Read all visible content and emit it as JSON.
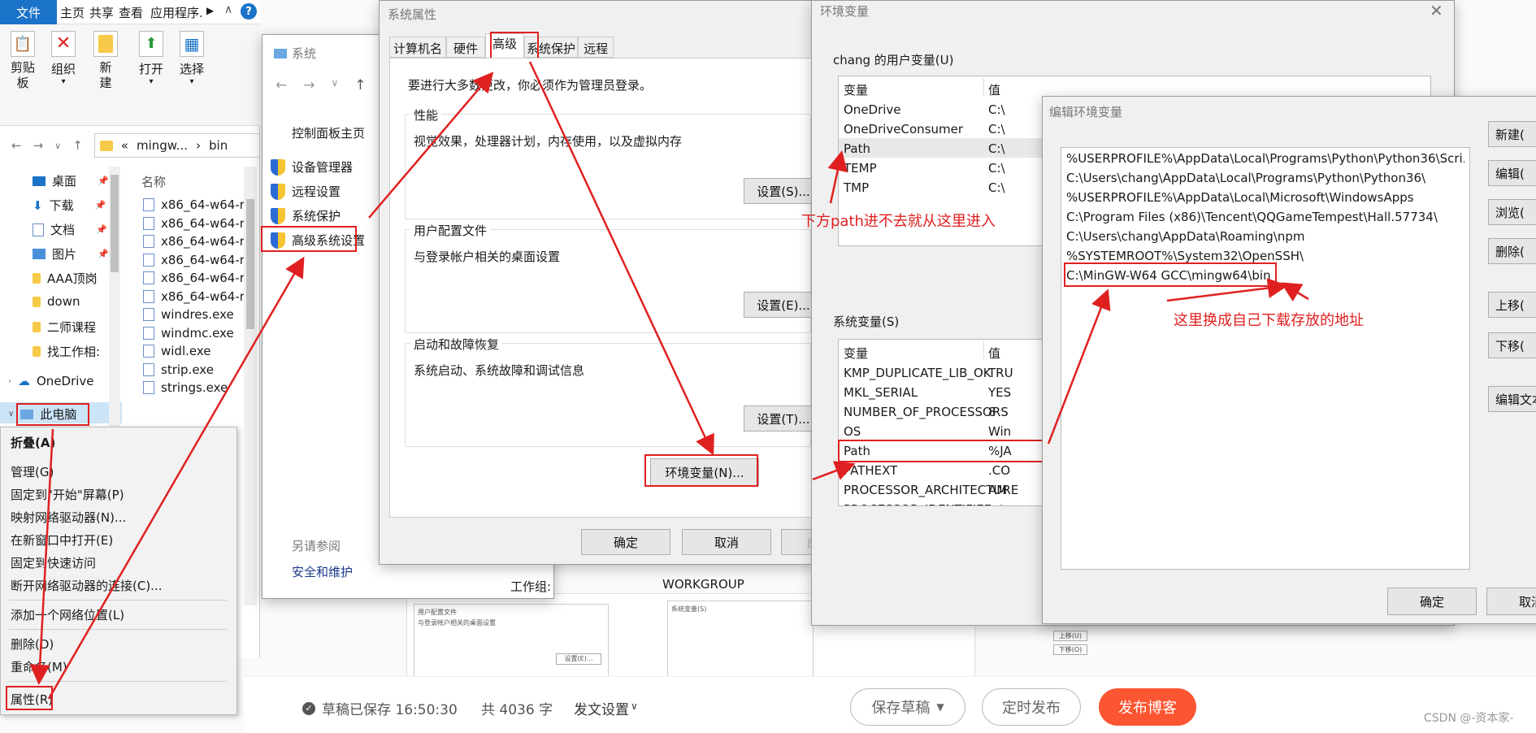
{
  "explorer": {
    "tabs": [
      "文件",
      "主页",
      "共享",
      "查看",
      "应用程序."
    ],
    "ribbon": [
      {
        "label": "剪贴\n板",
        "icon": "clipboard-icon"
      },
      {
        "label": "组织",
        "icon": "delete-x-icon"
      },
      {
        "label": "新\n建",
        "icon": "new-folder-icon"
      },
      {
        "label": "打开",
        "icon": "open-icon"
      },
      {
        "label": "选择",
        "icon": "select-icon"
      }
    ],
    "path_prefix": "«",
    "path": [
      "mingw...",
      "bin"
    ],
    "nav_items": [
      {
        "label": "桌面",
        "icon": "desktop-icon",
        "pinned": true
      },
      {
        "label": "下载",
        "icon": "download-icon",
        "pinned": true
      },
      {
        "label": "文档",
        "icon": "document-icon",
        "pinned": true
      },
      {
        "label": "图片",
        "icon": "picture-icon",
        "pinned": true
      },
      {
        "label": "AAA顶岗",
        "icon": "folder-icon",
        "pinned": false
      },
      {
        "label": "down",
        "icon": "folder-icon",
        "pinned": false
      },
      {
        "label": "二师课程",
        "icon": "folder-icon",
        "pinned": false
      },
      {
        "label": "找工作相:",
        "icon": "folder-icon",
        "pinned": false
      }
    ],
    "onedrive": "OneDrive",
    "this_pc": "此电脑",
    "column_name": "名称",
    "files": [
      "x86_64-w64-r",
      "x86_64-w64-r",
      "x86_64-w64-r",
      "x86_64-w64-r",
      "x86_64-w64-r",
      "x86_64-w64-r",
      "windres.exe",
      "windmc.exe",
      "widl.exe",
      "strip.exe",
      "strings.exe"
    ]
  },
  "context_menu": {
    "items": [
      "折叠(A)",
      "管理(G)",
      "固定到\"开始\"屏幕(P)",
      "映射网络驱动器(N)...",
      "在新窗口中打开(E)",
      "固定到快速访问",
      "断开网络驱动器的连接(C)...",
      "添加一个网络位置(L)",
      "删除(D)",
      "重命名(M)",
      "属性(R)"
    ]
  },
  "system_window": {
    "title": "系统",
    "home": "控制面板主页",
    "links": [
      "设备管理器",
      "远程设置",
      "系统保护",
      "高级系统设置"
    ],
    "see_also": "另请参阅",
    "security": "安全和维护",
    "workgroup_label": "工作组:",
    "workgroup_value": "WORKGROUP"
  },
  "sys_props": {
    "title": "系统属性",
    "tabs": [
      "计算机名",
      "硬件",
      "高级",
      "系统保护",
      "远程"
    ],
    "notice": "要进行大多数更改，你必须作为管理员登录。",
    "perf_title": "性能",
    "perf_desc": "视觉效果，处理器计划，内存使用，以及虚拟内存",
    "settings_s": "设置(S)...",
    "profile_title": "用户配置文件",
    "profile_desc": "与登录帐户相关的桌面设置",
    "settings_e": "设置(E)...",
    "startup_title": "启动和故障恢复",
    "startup_desc": "系统启动、系统故障和调试信息",
    "settings_t": "设置(T)...",
    "env_button": "环境变量(N)...",
    "ok": "确定",
    "cancel": "取消",
    "apply": "应"
  },
  "env_vars": {
    "title": "环境变量",
    "user_title": "chang 的用户变量(U)",
    "col_var": "变量",
    "col_val": "值",
    "user_rows": [
      {
        "name": "OneDrive",
        "value": "C:\\"
      },
      {
        "name": "OneDriveConsumer",
        "value": "C:\\"
      },
      {
        "name": "Path",
        "value": "C:\\"
      },
      {
        "name": "TEMP",
        "value": "C:\\"
      },
      {
        "name": "TMP",
        "value": "C:\\"
      }
    ],
    "sys_title": "系统变量(S)",
    "sys_rows": [
      {
        "name": "KMP_DUPLICATE_LIB_OK",
        "value": "TRU"
      },
      {
        "name": "MKL_SERIAL",
        "value": "YES"
      },
      {
        "name": "NUMBER_OF_PROCESSORS",
        "value": "8"
      },
      {
        "name": "OS",
        "value": "Win"
      },
      {
        "name": "Path",
        "value": "%JA"
      },
      {
        "name": "PATHEXT",
        "value": ".CO"
      },
      {
        "name": "PROCESSOR_ARCHITECTURE",
        "value": "AM"
      },
      {
        "name": "PROCESSOR_IDENTIFIER",
        "value": "Int"
      }
    ]
  },
  "edit_env": {
    "title": "编辑环境变量",
    "entries": [
      "%USERPROFILE%\\AppData\\Local\\Programs\\Python\\Python36\\Scri...",
      "C:\\Users\\chang\\AppData\\Local\\Programs\\Python\\Python36\\",
      "%USERPROFILE%\\AppData\\Local\\Microsoft\\WindowsApps",
      "C:\\Program Files (x86)\\Tencent\\QQGameTempest\\Hall.57734\\",
      "C:\\Users\\chang\\AppData\\Roaming\\npm",
      "%SYSTEMROOT%\\System32\\OpenSSH\\",
      "C:\\MinGW-W64 GCC\\mingw64\\bin"
    ],
    "buttons": [
      "新建(",
      "编辑(",
      "浏览(",
      "删除(",
      "上移(",
      "下移(",
      "编辑文本"
    ],
    "ok": "确定",
    "cancel": "取消"
  },
  "annotations": {
    "path_hint": "下方path进不去就从这里进入",
    "address_hint": "这里换成自己下载存放的地址"
  },
  "bottom_bar": {
    "saved": "草稿已保存 16:50:30",
    "count": "共 4036 字",
    "publish_settings": "发文设置",
    "save_draft": "保存草稿",
    "schedule": "定时发布",
    "publish": "发布博客",
    "watermark": "CSDN @-资本家-"
  },
  "colors": {
    "accent_red": "#e02020",
    "publish": "#fc5531",
    "explorer_blue": "#1a73c8"
  }
}
